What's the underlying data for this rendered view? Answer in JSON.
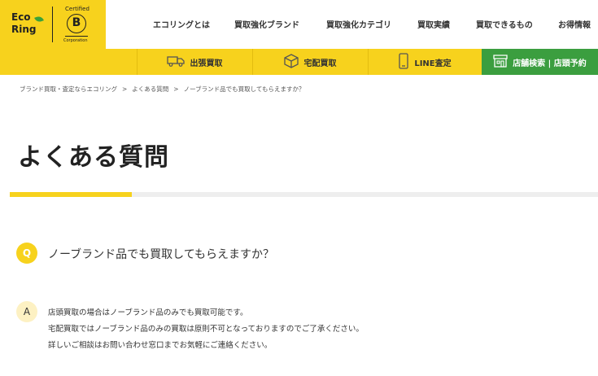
{
  "logo": {
    "line1": "Eco",
    "line2": "Ring",
    "bcorp_certified": "Certified",
    "bcorp_letter": "B",
    "bcorp_corporation": "Corporation"
  },
  "nav_top": [
    {
      "label": "エコリングとは"
    },
    {
      "label": "買取強化ブランド"
    },
    {
      "label": "買取強化カテゴリ"
    },
    {
      "label": "買取実績"
    },
    {
      "label": "買取できるもの"
    },
    {
      "label": "お得情報"
    }
  ],
  "nav_bar": {
    "items": [
      {
        "label": "出張買取",
        "icon": "truck-icon"
      },
      {
        "label": "宅配買取",
        "icon": "box-icon"
      },
      {
        "label": "LINE査定",
        "icon": "smartphone-icon"
      }
    ],
    "store": {
      "label": "店舗検索 | 店頭予約",
      "icon": "store-icon"
    }
  },
  "breadcrumb": [
    {
      "label": "ブランド買取・査定ならエコリング"
    },
    {
      "label": "よくある質問"
    },
    {
      "label": "ノーブランド品でも買取してもらえますか？"
    }
  ],
  "breadcrumb_sep": ">",
  "page_title": "よくある質問",
  "faq": {
    "q_label": "Q",
    "question": "ノーブランド品でも買取してもらえますか？",
    "a_label": "A",
    "answer_lines": [
      "店頭買取の場合はノーブランド品のみでも買取可能です。",
      "宅配買取ではノーブランド品のみの買取は原則不可となっておりますのでご了承ください。",
      "詳しいご相談はお問い合わせ窓口までお気軽にご連絡ください。"
    ]
  },
  "colors": {
    "brand_yellow": "#f7d21d",
    "store_green": "#3b9e3f",
    "answer_badge": "#fdf1c3"
  }
}
